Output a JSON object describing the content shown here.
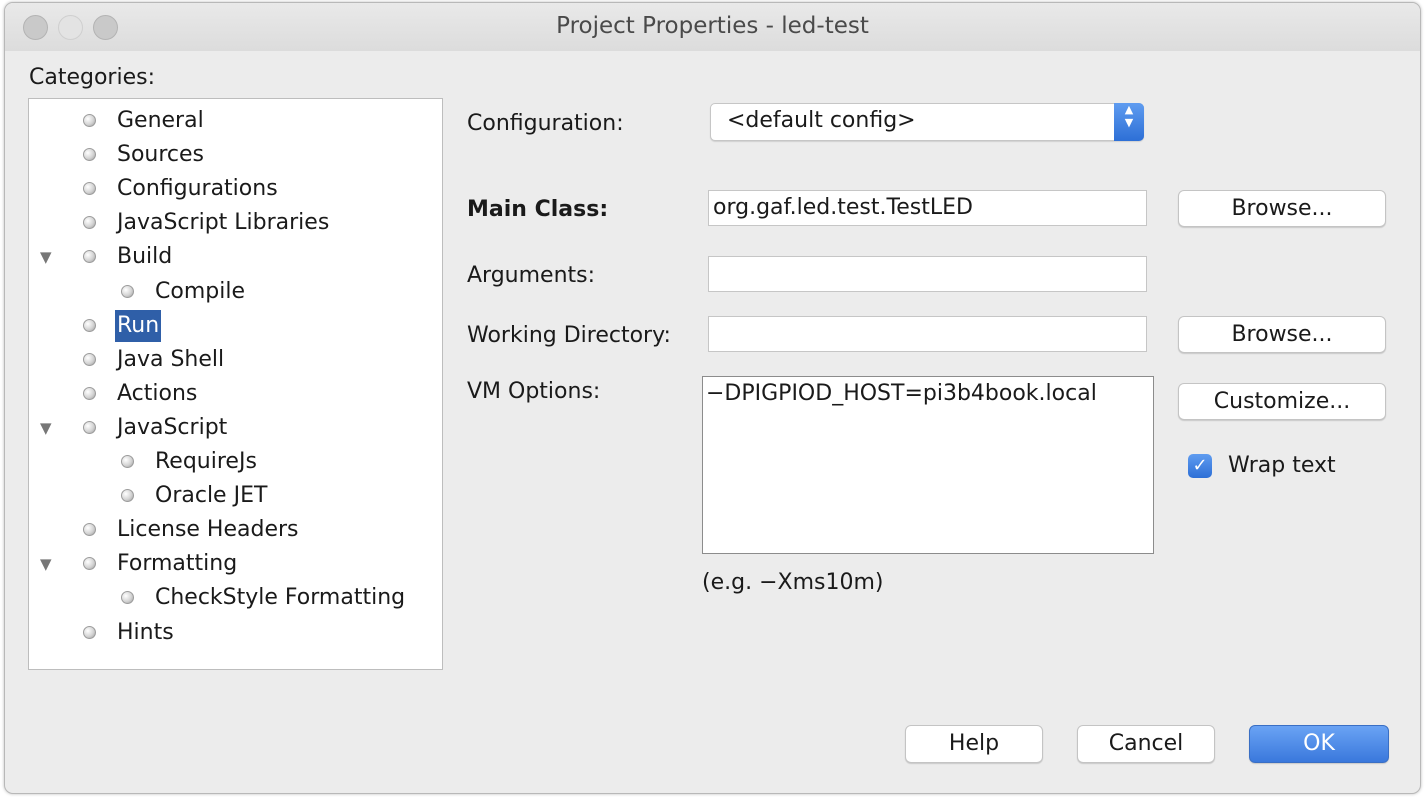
{
  "window": {
    "title": "Project Properties - led-test"
  },
  "categories": {
    "label": "Categories:",
    "items": [
      {
        "label": "General",
        "level": 0,
        "expanded": null,
        "selected": false
      },
      {
        "label": "Sources",
        "level": 0,
        "expanded": null,
        "selected": false
      },
      {
        "label": "Configurations",
        "level": 0,
        "expanded": null,
        "selected": false
      },
      {
        "label": "JavaScript Libraries",
        "level": 0,
        "expanded": null,
        "selected": false
      },
      {
        "label": "Build",
        "level": 0,
        "expanded": true,
        "selected": false
      },
      {
        "label": "Compile",
        "level": 1,
        "expanded": null,
        "selected": false
      },
      {
        "label": "Run",
        "level": 0,
        "expanded": null,
        "selected": true
      },
      {
        "label": "Java Shell",
        "level": 0,
        "expanded": null,
        "selected": false
      },
      {
        "label": "Actions",
        "level": 0,
        "expanded": null,
        "selected": false
      },
      {
        "label": "JavaScript",
        "level": 0,
        "expanded": true,
        "selected": false
      },
      {
        "label": "RequireJs",
        "level": 1,
        "expanded": null,
        "selected": false
      },
      {
        "label": "Oracle JET",
        "level": 1,
        "expanded": null,
        "selected": false
      },
      {
        "label": "License Headers",
        "level": 0,
        "expanded": null,
        "selected": false
      },
      {
        "label": "Formatting",
        "level": 0,
        "expanded": true,
        "selected": false
      },
      {
        "label": "CheckStyle Formatting",
        "level": 1,
        "expanded": null,
        "selected": false
      },
      {
        "label": "Hints",
        "level": 0,
        "expanded": null,
        "selected": false
      }
    ]
  },
  "form": {
    "configuration_label": "Configuration:",
    "configuration_value": "<default config>",
    "main_class_label": "Main Class:",
    "main_class_value": "org.gaf.led.test.TestLED",
    "main_class_browse": "Browse...",
    "arguments_label": "Arguments:",
    "arguments_value": "",
    "working_dir_label": "Working Directory:",
    "working_dir_value": "",
    "working_dir_browse": "Browse...",
    "vm_options_label": "VM Options:",
    "vm_options_value": "−DPIGPIOD_HOST=pi3b4book.local",
    "customize": "Customize...",
    "wrap_text_label": "Wrap text",
    "wrap_text_checked": true,
    "hint": "(e.g. −Xms10m)"
  },
  "buttons": {
    "help": "Help",
    "cancel": "Cancel",
    "ok": "OK"
  },
  "icons": {
    "expand": "triangle-down-icon",
    "node": "node-bullet-icon",
    "dropdown": "updown-chevron-icon",
    "check": "checkmark-icon"
  }
}
